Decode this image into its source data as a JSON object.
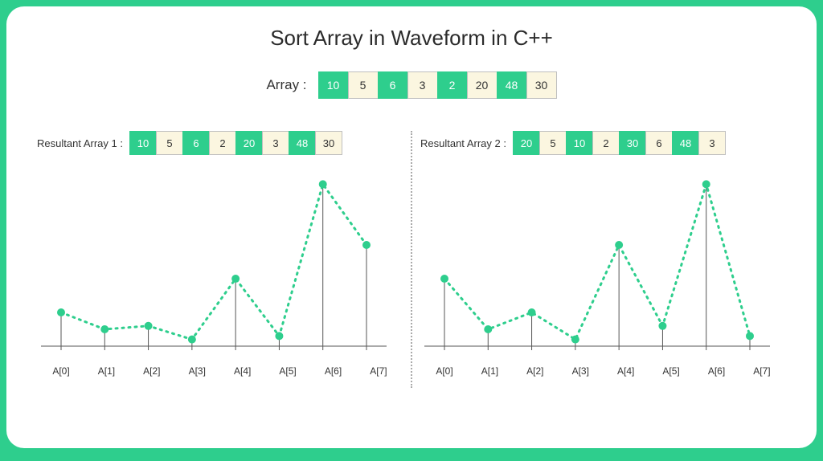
{
  "title": "Sort Array in Waveform in C++",
  "input_label": "Array  :",
  "input_array": [
    10,
    5,
    6,
    3,
    2,
    20,
    48,
    30
  ],
  "colors": {
    "green": "#2ECE8D",
    "cream": "#FBF6E0"
  },
  "result1_label": "Resultant Array 1 :",
  "result1_array": [
    10,
    5,
    6,
    2,
    20,
    3,
    48,
    30
  ],
  "result2_label": "Resultant Array 2 :",
  "result2_array": [
    20,
    5,
    10,
    2,
    30,
    6,
    48,
    3
  ],
  "axis_labels": [
    "A[0]",
    "A[1]",
    "A[2]",
    "A[3]",
    "A[4]",
    "A[5]",
    "A[6]",
    "A[7]"
  ],
  "chart_data": [
    {
      "type": "line",
      "title": "Resultant Array 1 waveform",
      "categories": [
        "A[0]",
        "A[1]",
        "A[2]",
        "A[3]",
        "A[4]",
        "A[5]",
        "A[6]",
        "A[7]"
      ],
      "values": [
        10,
        5,
        6,
        2,
        20,
        3,
        48,
        30
      ],
      "xlabel": "",
      "ylabel": "",
      "ylim": [
        0,
        50
      ]
    },
    {
      "type": "line",
      "title": "Resultant Array 2 waveform",
      "categories": [
        "A[0]",
        "A[1]",
        "A[2]",
        "A[3]",
        "A[4]",
        "A[5]",
        "A[6]",
        "A[7]"
      ],
      "values": [
        20,
        5,
        10,
        2,
        30,
        6,
        48,
        3
      ],
      "xlabel": "",
      "ylabel": "",
      "ylim": [
        0,
        50
      ]
    }
  ]
}
